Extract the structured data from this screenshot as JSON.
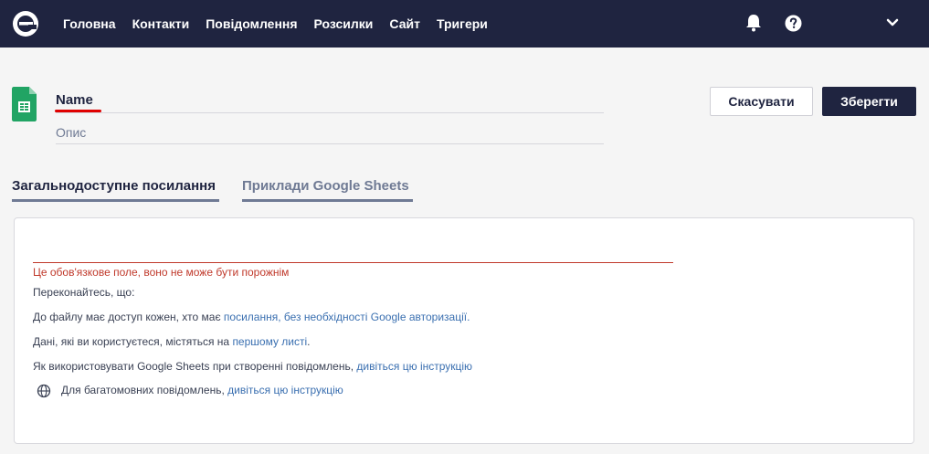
{
  "nav": {
    "items": [
      "Головна",
      "Контакти",
      "Повідомлення",
      "Розсилки",
      "Сайт",
      "Тригери"
    ]
  },
  "header": {
    "name_value": "Name",
    "description_placeholder": "Опис",
    "cancel_label": "Скасувати",
    "save_label": "Зберегти"
  },
  "tabs": [
    {
      "label": "Загальнодоступне посилання",
      "active": true
    },
    {
      "label": "Приклади Google Sheets",
      "active": false
    }
  ],
  "card": {
    "error": "Це обов'язкове поле, воно не може бути порожнім",
    "ensure": "Переконайтесь, що:",
    "line1_pre": "До файлу має доступ кожен, хто має ",
    "line1_link": "посилання, без необхідності Google авторизації.",
    "line2_pre": "Дані, які ви користуєтеся, містяться на ",
    "line2_link": "першому листі",
    "line2_post": ".",
    "line3_pre": "Як використовувати Google Sheets при створенні повідомлень, ",
    "line3_link": "дивіться цю інструкцію",
    "line4_pre": "Для багатомовних повідомлень, ",
    "line4_link": "дивіться цю інструкцію"
  },
  "colors": {
    "navbar": "#1f2440",
    "error": "#c0392b",
    "link": "#3a6fb0",
    "sheets_green": "#21a464"
  },
  "icons": [
    "e-logo-icon",
    "bell-icon",
    "help-icon",
    "chevron-down-icon",
    "google-sheets-icon",
    "globe-icon"
  ]
}
